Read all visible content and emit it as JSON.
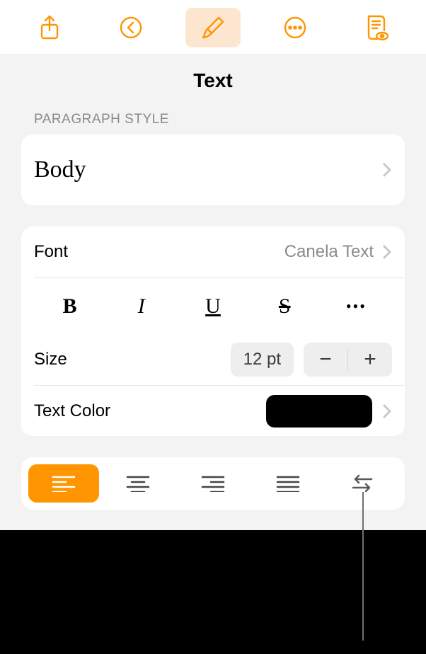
{
  "panel": {
    "title": "Text"
  },
  "paragraph_style": {
    "label": "PARAGRAPH STYLE",
    "value": "Body"
  },
  "font": {
    "label": "Font",
    "value": "Canela Text"
  },
  "size": {
    "label": "Size",
    "value": "12 pt"
  },
  "text_color": {
    "label": "Text Color",
    "swatch": "#000000"
  },
  "style_buttons": {
    "bold": "B",
    "italic": "I",
    "underline": "U",
    "strike": "S",
    "more": "•••"
  },
  "stepper": {
    "minus": "−",
    "plus": "+"
  },
  "alignment": {
    "active": "left"
  }
}
